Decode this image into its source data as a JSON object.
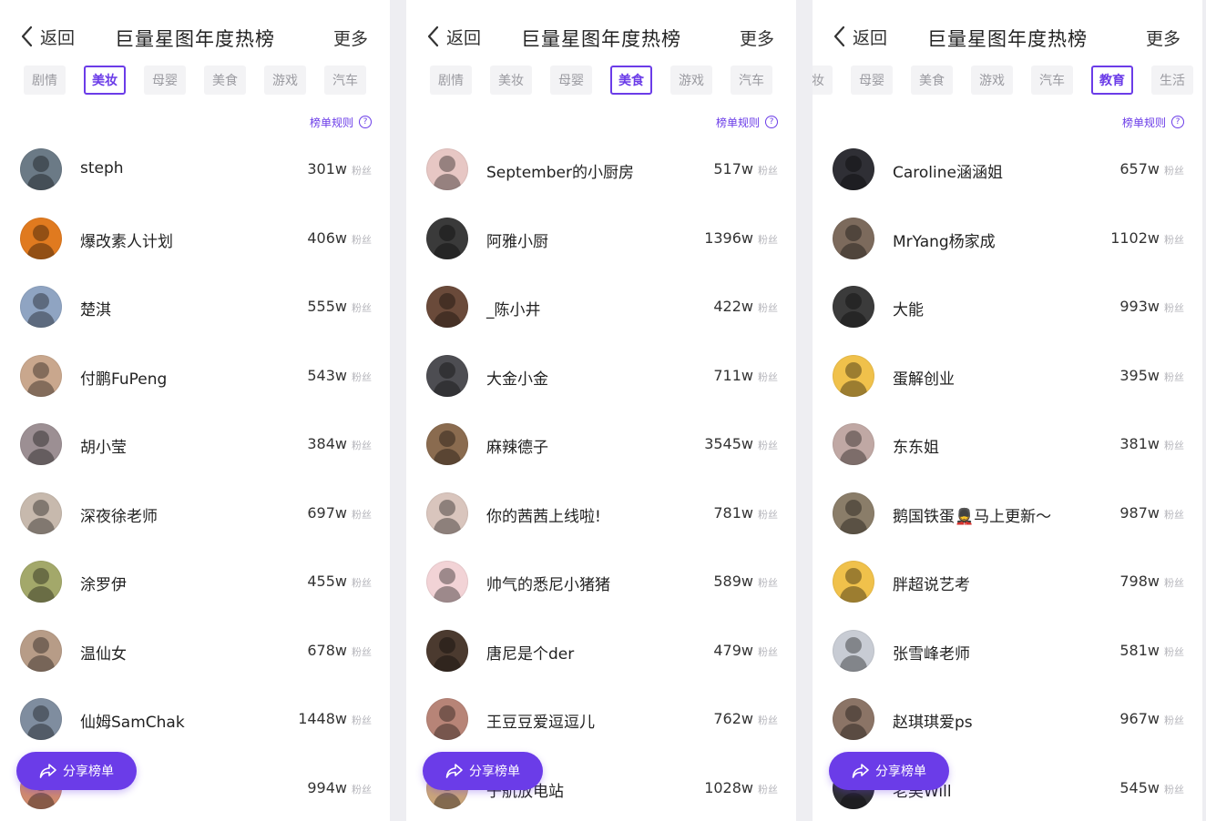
{
  "panels": [
    {
      "back_label": "返回",
      "title": "巨量星图年度热榜",
      "more_label": "更多",
      "tabs": [
        "剧情",
        "美妆",
        "母婴",
        "美食",
        "游戏",
        "汽车"
      ],
      "active_tab": 1,
      "rules_label": "榜单规则",
      "share_label": "分享榜单",
      "fans_unit": "粉丝",
      "rows": [
        {
          "name": "steph",
          "count": "301w",
          "color": "#6b7a86"
        },
        {
          "name": "爆改素人计划",
          "count": "406w",
          "color": "#e07a1f"
        },
        {
          "name": "楚淇",
          "count": "555w",
          "color": "#8fa4c2"
        },
        {
          "name": "付鹏FuPeng",
          "count": "543w",
          "color": "#c9a78d"
        },
        {
          "name": "胡小莹",
          "count": "384w",
          "color": "#9c8f93"
        },
        {
          "name": "深夜徐老师",
          "count": "697w",
          "color": "#c7b9ad"
        },
        {
          "name": "涂罗伊",
          "count": "455w",
          "color": "#a3a86a"
        },
        {
          "name": "温仙女",
          "count": "678w",
          "color": "#b79c87"
        },
        {
          "name": "仙姆SamChak",
          "count": "1448w",
          "color": "#7f8d9f"
        },
        {
          "name": "",
          "count": "994w",
          "color": "#d08a6e"
        }
      ]
    },
    {
      "back_label": "返回",
      "title": "巨量星图年度热榜",
      "more_label": "更多",
      "tabs": [
        "剧情",
        "美妆",
        "母婴",
        "美食",
        "游戏",
        "汽车"
      ],
      "active_tab": 3,
      "rules_label": "榜单规则",
      "share_label": "分享榜单",
      "fans_unit": "粉丝",
      "rows": [
        {
          "name": "September的小厨房",
          "count": "517w",
          "color": "#e7c7c4"
        },
        {
          "name": "阿雅小厨",
          "count": "1396w",
          "color": "#3a3a3a"
        },
        {
          "name": "_陈小井",
          "count": "422w",
          "color": "#6a4a3a"
        },
        {
          "name": "大金小金",
          "count": "711w",
          "color": "#4d4d52"
        },
        {
          "name": "麻辣德子",
          "count": "3545w",
          "color": "#8a6b4f"
        },
        {
          "name": "你的茜茜上线啦!",
          "count": "781w",
          "color": "#d9c5bd"
        },
        {
          "name": "帅气的悉尼小猪猪",
          "count": "589w",
          "color": "#f2d3d6"
        },
        {
          "name": "唐尼是个der",
          "count": "479w",
          "color": "#4b3a2f"
        },
        {
          "name": "王豆豆爱逗逗儿",
          "count": "762w",
          "color": "#b78477"
        },
        {
          "name": "子航放电站",
          "count": "1028w",
          "color": "#c9a47a"
        }
      ]
    },
    {
      "back_label": "返回",
      "title": "巨量星图年度热榜",
      "more_label": "更多",
      "tabs": [
        "美妆",
        "母婴",
        "美食",
        "游戏",
        "汽车",
        "教育",
        "生活"
      ],
      "active_tab": 5,
      "rules_label": "榜单规则",
      "share_label": "分享榜单",
      "fans_unit": "粉丝",
      "rows": [
        {
          "name": "Caroline涵涵姐",
          "count": "657w",
          "color": "#2f2f35"
        },
        {
          "name": "MrYang杨家成",
          "count": "1102w",
          "color": "#7c6a5c"
        },
        {
          "name": "大能",
          "count": "993w",
          "color": "#3b3b3b"
        },
        {
          "name": "蛋解创业",
          "count": "395w",
          "color": "#f0c14b"
        },
        {
          "name": "东东姐",
          "count": "381w",
          "color": "#c0a8a4"
        },
        {
          "name": "鹅国铁蛋💂马上更新～",
          "count": "987w",
          "color": "#8a7d69"
        },
        {
          "name": "胖超说艺考",
          "count": "798w",
          "color": "#f0c14b"
        },
        {
          "name": "张雪峰老师",
          "count": "581w",
          "color": "#c8ccd4"
        },
        {
          "name": "赵琪琪爱ps",
          "count": "967w",
          "color": "#8b7466"
        },
        {
          "name": "老吴Will",
          "count": "545w",
          "color": "#2e2e33"
        }
      ]
    }
  ]
}
